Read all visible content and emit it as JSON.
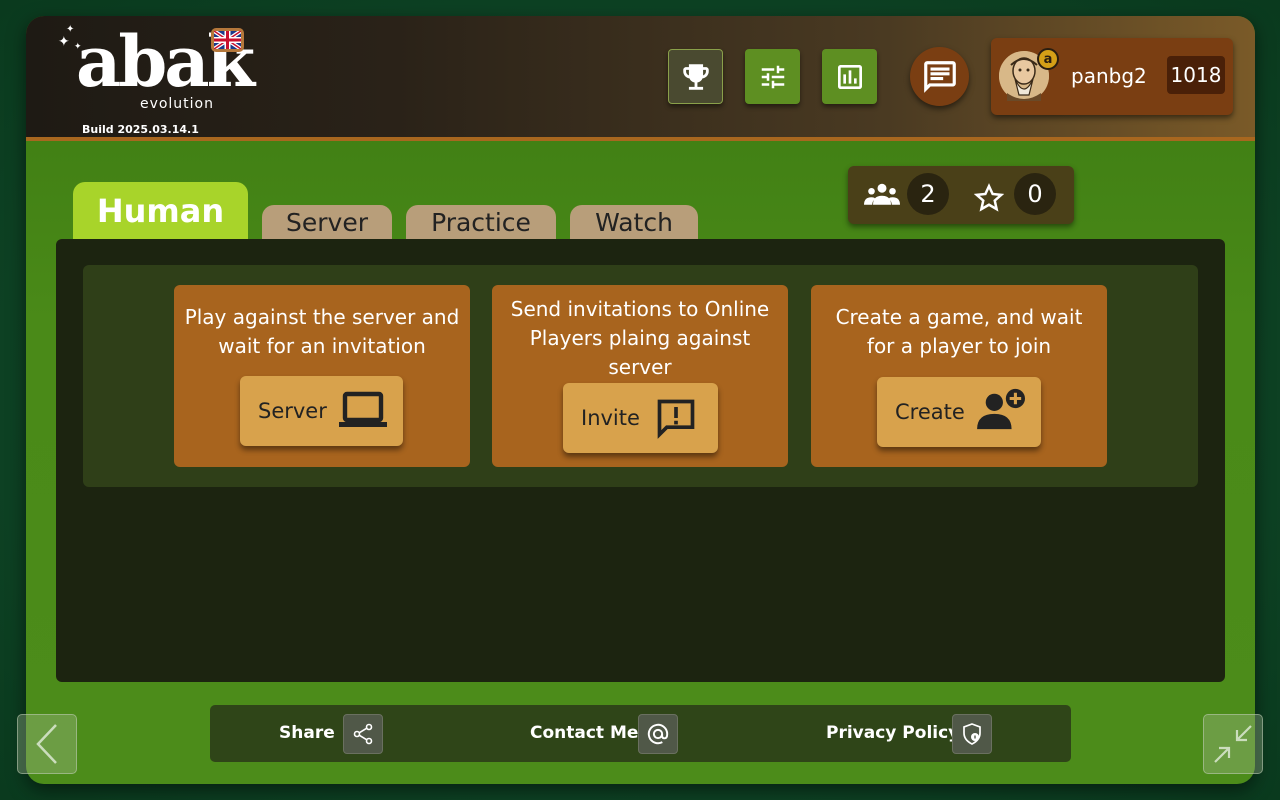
{
  "header": {
    "logo_text": "abak",
    "logo_subtitle": "evolution",
    "build": "Build 2025.03.14.1",
    "language_icon": "uk-flag-icon",
    "buttons": [
      {
        "icon": "trophy-icon"
      },
      {
        "icon": "sliders-icon"
      },
      {
        "icon": "bar-chart-icon"
      }
    ],
    "chat_icon": "chat-icon",
    "user": {
      "name": "panbg2",
      "rating": "1018",
      "avatar_badge": "a"
    }
  },
  "counters": {
    "players_icon": "players-icon",
    "players": "2",
    "favorites_icon": "star-icon",
    "favorites": "0"
  },
  "tabs": [
    {
      "label": "Human",
      "active": true
    },
    {
      "label": "Server",
      "active": false
    },
    {
      "label": "Practice",
      "active": false
    },
    {
      "label": "Watch",
      "active": false
    }
  ],
  "cards": [
    {
      "text": "Play against the server and wait for an invitation",
      "button": "Server",
      "icon": "laptop-icon"
    },
    {
      "text": "Send invitations to Online Players plaing against server",
      "button": "Invite",
      "icon": "feedback-icon"
    },
    {
      "text": "Create a game, and wait for a player to join",
      "button": "Create",
      "icon": "add-person-icon"
    }
  ],
  "footer": {
    "share": "Share",
    "contact": "Contact Me",
    "privacy": "Privacy Policy"
  },
  "colors": {
    "active_tab": "#a8d42a",
    "card": "#a8641e",
    "card_button": "#d8a24c",
    "header_accent": "#a8671f"
  }
}
